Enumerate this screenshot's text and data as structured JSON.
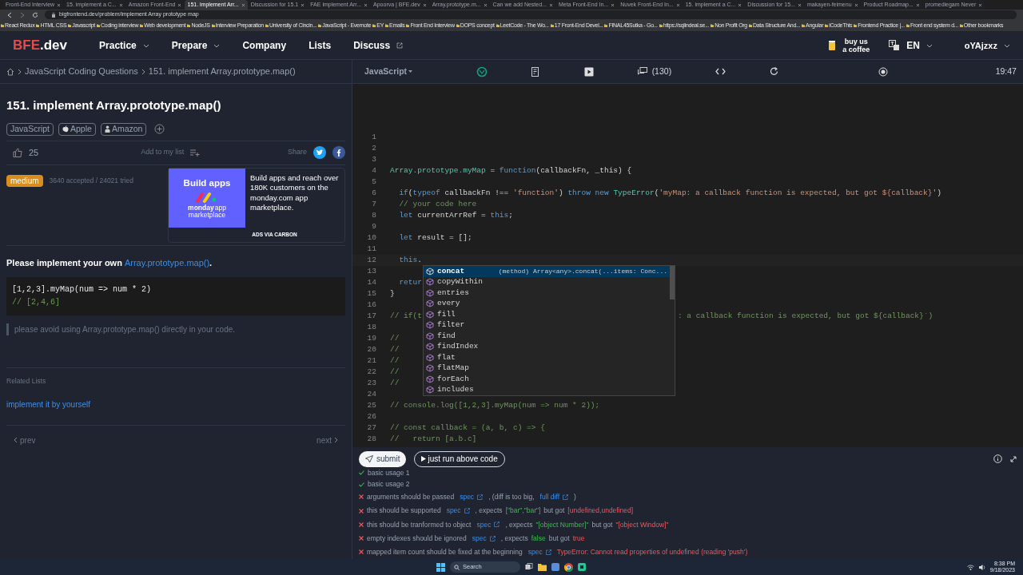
{
  "browser": {
    "tabs": [
      {
        "title": "Front-End Interview",
        "selected": false
      },
      {
        "title": "15. implement a C...",
        "selected": false
      },
      {
        "title": "Amazon Front-End",
        "selected": false
      },
      {
        "title": "151. implement Arr...",
        "selected": true
      },
      {
        "title": "Discussion for 15.1",
        "selected": false
      },
      {
        "title": "FAE implement Arr...",
        "selected": false
      },
      {
        "title": "Apoorva | BFE.dev",
        "selected": false
      },
      {
        "title": "Array.prototype.m...",
        "selected": false
      },
      {
        "title": "Can we add Nested...",
        "selected": false
      },
      {
        "title": "Meta Front-End In...",
        "selected": false
      },
      {
        "title": "Nuvek Front-End In...",
        "selected": false
      },
      {
        "title": "15. implement a C...",
        "selected": false
      },
      {
        "title": "Discussion for 15...",
        "selected": false
      },
      {
        "title": "makayen-feimenu",
        "selected": false
      },
      {
        "title": "Product Roadmap...",
        "selected": false
      },
      {
        "title": "promediegam Never",
        "selected": false
      }
    ],
    "url": "bigfrontend.dev/problem/implement Array prototype map",
    "bookmarks": [
      "React Redux",
      "HTML CSS",
      "Javascript",
      "Coding interview",
      "Web development",
      "NodeJS",
      "Interview Preparation",
      "University of Cincin...",
      "JavaScript - Evernote",
      "EY",
      "Emails",
      "Front End Interview",
      "DOPS concept",
      "LeetCode - The Wo...",
      "17 Front-End Devel...",
      "FINAL45Sutka - Go...",
      "https://sqlindeal.se...",
      "Non Profit Org",
      "Data Structure And...",
      "Angular",
      "iCodeThis",
      "Frontend Practice |...",
      "Front end system d...",
      "Other bookmarks"
    ]
  },
  "header": {
    "logo": [
      "BFE",
      ".dev"
    ],
    "nav": [
      {
        "label": "Practice",
        "kind": "dropdown"
      },
      {
        "label": "Prepare",
        "kind": "dropdown"
      },
      {
        "label": "Company",
        "kind": "plain"
      },
      {
        "label": "Lists",
        "kind": "plain"
      },
      {
        "label": "Discuss",
        "kind": "external"
      }
    ],
    "coffee": "buy us a coffee",
    "language": "EN",
    "user": "oYAjzxz"
  },
  "breadcrumb": [
    "JavaScript Coding Questions",
    "151. implement Array.prototype.map()"
  ],
  "problem": {
    "title": "151. implement Array.prototype.map()",
    "tags": [
      {
        "label": "JavaScript",
        "kind": "plain"
      },
      {
        "label": "Apple",
        "kind": "apple"
      },
      {
        "label": "Amazon",
        "kind": "amazon"
      }
    ],
    "likes": "25",
    "add_to_list": "Add to my list",
    "share": "Share",
    "difficulty": "medium",
    "stats": "3640 accepted / 24021 tried",
    "ad": {
      "headline": "Build apps",
      "brand": "monday",
      "brand_suffix": "app",
      "brand_line2": "marketplace",
      "text": "Build apps and reach over 180K customers on the monday.com app marketplace.",
      "via": "ADS VIA CARBON"
    },
    "prompt": "Please implement your own",
    "prompt_link": "Array.prototype.map()",
    "prompt_end": ".",
    "example": [
      "[1,2,3].myMap(num => num * 2)",
      "// [2,4,6]"
    ],
    "note": "please avoid using Array.prototype.map() directly in your code.",
    "related_title": "Related Lists",
    "related": [
      "implement it by yourself"
    ],
    "prev": "prev",
    "next": "next"
  },
  "toolbar": {
    "language": "JavaScript",
    "comments": "(130)",
    "time": "19:47"
  },
  "editor": {
    "lines": [
      {
        "n": "1"
      },
      {
        "n": "2"
      },
      {
        "n": "3"
      },
      {
        "n": "4",
        "segments": [
          [
            {
              "t": "Array.prototype.myMap",
              "kind": "type"
            },
            {
              "t": " = ",
              "kind": "plain"
            },
            {
              "t": "function",
              "kind": "keyword"
            },
            {
              "t": "(callbackFn, _this) {",
              "kind": "plain"
            }
          ]
        ]
      },
      {
        "n": "5"
      },
      {
        "n": "6",
        "segments": [
          [
            {
              "t": "  if",
              "kind": "keyword"
            },
            {
              "t": "(",
              "kind": "plain"
            },
            {
              "t": "typeof",
              "kind": "keyword"
            },
            {
              "t": " callbackFn !== ",
              "kind": "plain"
            },
            {
              "t": "'function'",
              "kind": "string"
            },
            {
              "t": ") ",
              "kind": "plain"
            },
            {
              "t": "throw new ",
              "kind": "keyword"
            },
            {
              "t": "TypeError",
              "kind": "type"
            },
            {
              "t": "(",
              "kind": "plain"
            },
            {
              "t": "'myMap: a callback function is expected, but got ${callback}'",
              "kind": "string"
            },
            {
              "t": ")",
              "kind": "plain"
            }
          ]
        ]
      },
      {
        "n": "7",
        "segments": [
          [
            {
              "t": "  // your code here",
              "kind": "comment"
            }
          ]
        ]
      },
      {
        "n": "8",
        "segments": [
          [
            {
              "t": "  let",
              "kind": "keyword"
            },
            {
              "t": " currentArrRef = ",
              "kind": "plain"
            },
            {
              "t": "this",
              "kind": "keyword"
            },
            {
              "t": ";",
              "kind": "plain"
            }
          ]
        ]
      },
      {
        "n": "9"
      },
      {
        "n": "10",
        "segments": [
          [
            {
              "t": "  let",
              "kind": "keyword"
            },
            {
              "t": " result = [];",
              "kind": "plain"
            }
          ]
        ]
      },
      {
        "n": "11"
      },
      {
        "n": "12",
        "segments": [
          [
            {
              "t": "  this",
              "kind": "keyword"
            },
            {
              "t": ".",
              "kind": "plain"
            }
          ]
        ]
      },
      {
        "n": "13"
      },
      {
        "n": "14",
        "segments": [
          [
            {
              "t": "  retur",
              "kind": "keyword"
            }
          ]
        ]
      },
      {
        "n": "15",
        "segments": [
          [
            {
              "t": "}",
              "kind": "plain"
            }
          ]
        ]
      },
      {
        "n": "16"
      },
      {
        "n": "17",
        "segments": [
          [
            {
              "t": "// if(t",
              "kind": "comment"
            }
          ],
          [
            {
              "t": ": a callback function is expected, but got ${callback}`)",
              "kind": "comment"
            }
          ]
        ]
      },
      {
        "n": "18"
      },
      {
        "n": "19",
        "segments": [
          [
            {
              "t": "//",
              "kind": "comment"
            }
          ]
        ]
      },
      {
        "n": "20",
        "segments": [
          [
            {
              "t": "//",
              "kind": "comment"
            }
          ]
        ]
      },
      {
        "n": "21",
        "segments": [
          [
            {
              "t": "//",
              "kind": "comment"
            }
          ]
        ]
      },
      {
        "n": "22",
        "segments": [
          [
            {
              "t": "//",
              "kind": "comment"
            }
          ]
        ]
      },
      {
        "n": "23",
        "segments": [
          [
            {
              "t": "//",
              "kind": "comment"
            }
          ]
        ]
      },
      {
        "n": "24"
      },
      {
        "n": "25",
        "segments": [
          [
            {
              "t": "// console.log([1,2,3].myMap(num => num * 2));",
              "kind": "comment"
            }
          ]
        ]
      },
      {
        "n": "26"
      },
      {
        "n": "27",
        "segments": [
          [
            {
              "t": "// const callback = (a, b, c) => {",
              "kind": "comment"
            }
          ]
        ]
      },
      {
        "n": "28",
        "segments": [
          [
            {
              "t": "//   return [a.b.c]",
              "kind": "comment"
            }
          ]
        ]
      }
    ],
    "suggestions": [
      {
        "label": "concat",
        "selected": true,
        "detail": "(method) Array<any>.concat(...items: Conc..."
      },
      {
        "label": "copyWithin",
        "selected": false
      },
      {
        "label": "entries",
        "selected": false
      },
      {
        "label": "every",
        "selected": false
      },
      {
        "label": "fill",
        "selected": false
      },
      {
        "label": "filter",
        "selected": false
      },
      {
        "label": "find",
        "selected": false
      },
      {
        "label": "findIndex",
        "selected": false
      },
      {
        "label": "flat",
        "selected": false
      },
      {
        "label": "flatMap",
        "selected": false
      },
      {
        "label": "forEach",
        "selected": false
      },
      {
        "label": "includes",
        "selected": false
      }
    ]
  },
  "actions": {
    "submit": "submit",
    "run": "just run above code"
  },
  "results": [
    {
      "passed": true,
      "parts": [
        {
          "t": "basic usage 1",
          "kind": "text"
        }
      ]
    },
    {
      "passed": true,
      "parts": [
        {
          "t": "basic usage 2",
          "kind": "text"
        }
      ]
    },
    {
      "passed": false,
      "parts": [
        {
          "t": "arguments should be passed",
          "kind": "text"
        },
        {
          "t": "spec",
          "kind": "link"
        },
        {
          "t": ", (diff is too big,",
          "kind": "text"
        },
        {
          "t": "full diff",
          "kind": "link"
        },
        {
          "t": ")",
          "kind": "text"
        }
      ]
    },
    {
      "passed": false,
      "parts": [
        {
          "t": "this should be supported",
          "kind": "text"
        },
        {
          "t": "spec",
          "kind": "link"
        },
        {
          "t": ", expects",
          "kind": "text"
        },
        {
          "t": "[\"bar\",\"bar\"]",
          "kind": "expected"
        },
        {
          "t": "but got",
          "kind": "text"
        },
        {
          "t": "[undefined,undefined]",
          "kind": "got"
        }
      ]
    },
    {
      "passed": false,
      "parts": [
        {
          "t": "this should be tranformed to object",
          "kind": "text"
        },
        {
          "t": "spec",
          "kind": "link"
        },
        {
          "t": ", expects",
          "kind": "text"
        },
        {
          "t": "\"[object Number]\"",
          "kind": "expected"
        },
        {
          "t": "but got",
          "kind": "text"
        },
        {
          "t": "\"[object Window]\"",
          "kind": "got"
        }
      ]
    },
    {
      "passed": false,
      "parts": [
        {
          "t": "empty indexes should be ignored",
          "kind": "text"
        },
        {
          "t": "spec",
          "kind": "link"
        },
        {
          "t": ", expects",
          "kind": "text"
        },
        {
          "t": "false",
          "kind": "expected"
        },
        {
          "t": "but got",
          "kind": "text"
        },
        {
          "t": "true",
          "kind": "got"
        }
      ]
    },
    {
      "passed": false,
      "parts": [
        {
          "t": "mapped item count should be fixed at the beginning",
          "kind": "text"
        },
        {
          "t": "spec",
          "kind": "link"
        },
        {
          "t": "TypeError: Cannot read properties of undefined (reading 'push')",
          "kind": "got"
        }
      ]
    }
  ],
  "taskbar": {
    "search": "Search",
    "time": "8:38 PM",
    "date": "9/18/2023"
  }
}
